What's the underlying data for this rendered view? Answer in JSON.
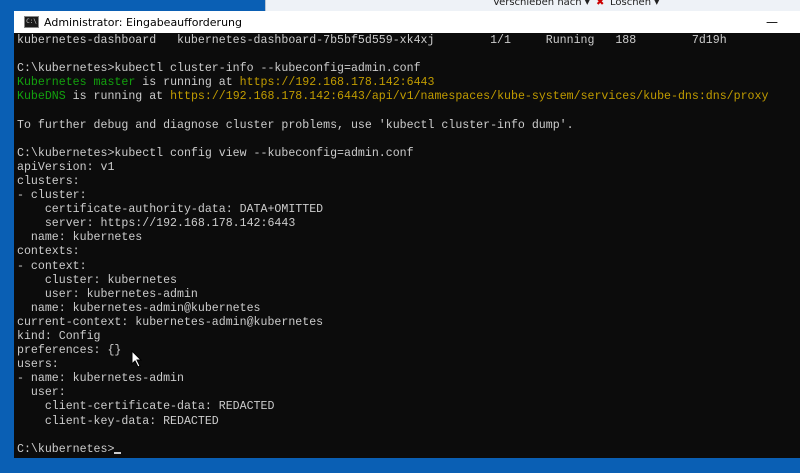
{
  "background_window": {
    "ribbon": {
      "move_to": "Verschieben nach ▾",
      "delete": "Löschen ▾"
    }
  },
  "window": {
    "title": "Administrator: Eingabeaufforderung",
    "minimize": "—"
  },
  "terminal": {
    "lines": [
      "kubernetes-dashboard   kubernetes-dashboard-7b5bf5d559-xk4xj        1/1     Running   188        7d19h",
      "",
      "C:\\kubernetes>kubectl cluster-info --kubeconfig=admin.conf",
      "",
      "",
      "",
      "To further debug and diagnose cluster problems, use 'kubectl cluster-info dump'.",
      "",
      "C:\\kubernetes>kubectl config view --kubeconfig=admin.conf",
      "apiVersion: v1",
      "clusters:",
      "- cluster:",
      "    certificate-authority-data: DATA+OMITTED",
      "    server: https://192.168.178.142:6443",
      "  name: kubernetes",
      "contexts:",
      "- context:",
      "    cluster: kubernetes",
      "    user: kubernetes-admin",
      "  name: kubernetes-admin@kubernetes",
      "current-context: kubernetes-admin@kubernetes",
      "kind: Config",
      "preferences: {}",
      "users:",
      "- name: kubernetes-admin",
      "  user:",
      "    client-certificate-data: REDACTED",
      "    client-key-data: REDACTED",
      "",
      "C:\\kubernetes>"
    ],
    "master_line": {
      "label": "Kubernetes master",
      "mid": " is running at ",
      "url": "https://192.168.178.142:6443"
    },
    "dns_line": {
      "label": "KubeDNS",
      "mid": " is running at ",
      "url": "https://192.168.178.142:6443/api/v1/namespaces/kube-system/services/kube-dns:dns/proxy"
    }
  }
}
